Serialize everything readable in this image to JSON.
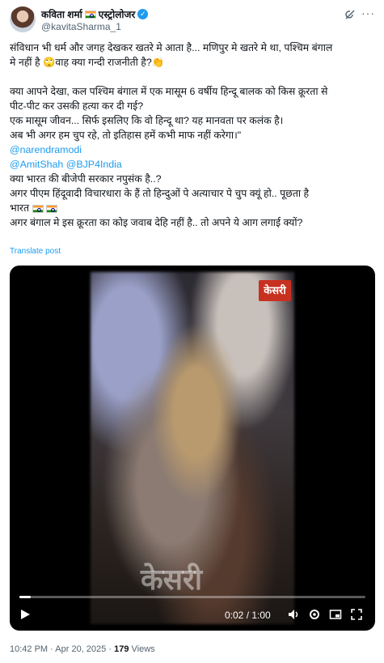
{
  "author": {
    "display_name": "कविता शर्मा",
    "display_name_suffix": "एस्ट्रोलोजर",
    "handle": "@kavitaSharma_1"
  },
  "tweet": {
    "lines": [
      "संविधान भी धर्म और जगह देखकर खतरे मे आता है... मणिपुर मे खतरे मे था, पश्चिम बंगाल",
      "मे नहीं है 🙄वाह क्या गन्दी राजनीती है?👏",
      "",
      "क्या आपने देखा, कल पश्चिम बंगाल में एक मासूम 6 वर्षीय हिन्दू बालक को किस क्रूरता से",
      "पीट-पीट कर उसकी हत्या कर दी गई?",
      "एक मासूम जीवन... सिर्फ इसलिए कि वो हिन्दू था? यह मानवता पर कलंक है।",
      " अब भी अगर हम चुप रहे, तो इतिहास हमें कभी माफ नहीं करेगा।\""
    ],
    "mention_1": "@narendramodi",
    "mention_2": "@AmitShah",
    "mention_3": "@BJP4India",
    "line_after_mentions_1": "क्या भारत की बीजेपी सरकार नपुसंक है..?",
    "line_after_mentions_2": "अगर पीएम हिंदूवादी विचारधारा के हैं तो हिन्दुओं पे अत्याचार पे चुप क्यूं हो.. पूछता है",
    "line_after_mentions_3": "भारत",
    "line_after_mentions_4": "अगर बंगाल मे इस क्रूरता का कोइ जवाब देहि नहीं है.. तो अपने ये आग लगाई क्यों?",
    "translate_label": "Translate post"
  },
  "video": {
    "watermark_top": "केसरी",
    "watermark_bottom": "केसरी",
    "time_display": "0:02 / 1:00",
    "progress_fraction": 0.033
  },
  "footer": {
    "time": "10:42 PM",
    "separator": "·",
    "date": "Apr 20, 2025",
    "views_count": "179",
    "views_label": "Views"
  },
  "icons": {
    "grok": "grok-icon",
    "more": "more-icon",
    "play": "play-icon",
    "volume": "volume-icon",
    "settings": "gear-icon",
    "pip": "picture-in-picture-icon",
    "fullscreen": "fullscreen-icon"
  },
  "colors": {
    "link": "#1d9bf0",
    "text": "#0f1419",
    "muted": "#536471",
    "watermark_red": "#c8301f"
  }
}
